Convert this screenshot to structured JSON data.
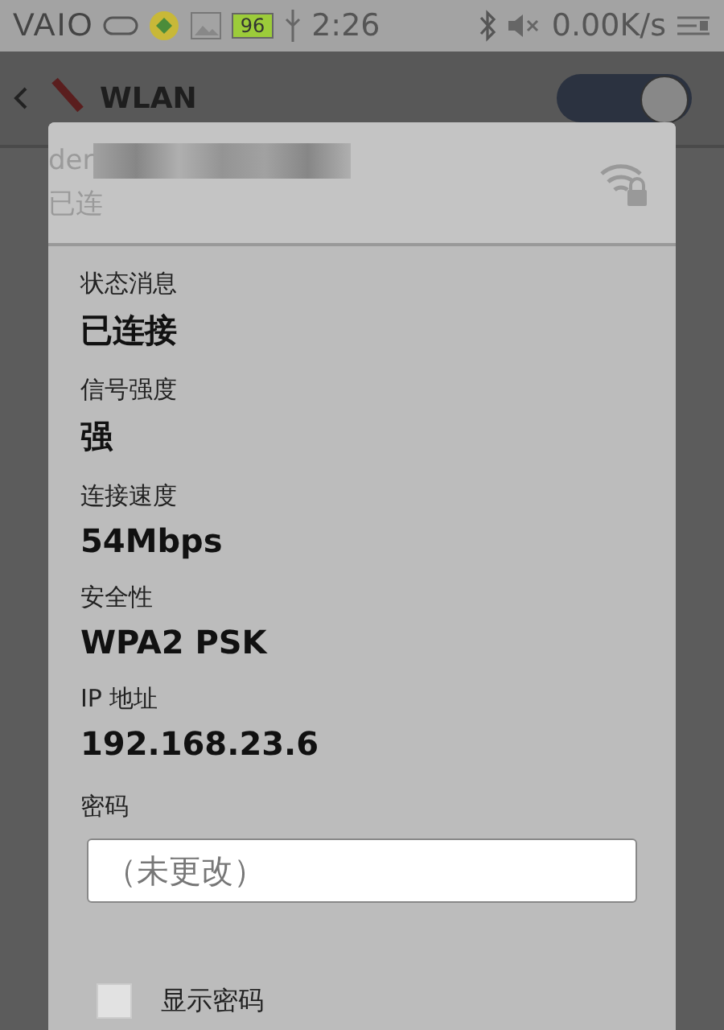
{
  "status_bar": {
    "logo": "VAIO",
    "battery": "96",
    "time": "2:26",
    "speed": "0.00K/s"
  },
  "header": {
    "title": "WLAN",
    "switch_on": true
  },
  "network_row": {
    "name": "der",
    "status": "已连"
  },
  "details": [
    {
      "label": "状态消息",
      "value": "已连接"
    },
    {
      "label": "信号强度",
      "value": "强"
    },
    {
      "label": "连接速度",
      "value": "54Mbps"
    },
    {
      "label": "安全性",
      "value": "WPA2 PSK"
    },
    {
      "label": "IP 地址",
      "value": "192.168.23.6"
    }
  ],
  "password": {
    "label": "密码",
    "placeholder": "（未更改）"
  },
  "show_password": {
    "label": "显示密码",
    "checked": false
  }
}
